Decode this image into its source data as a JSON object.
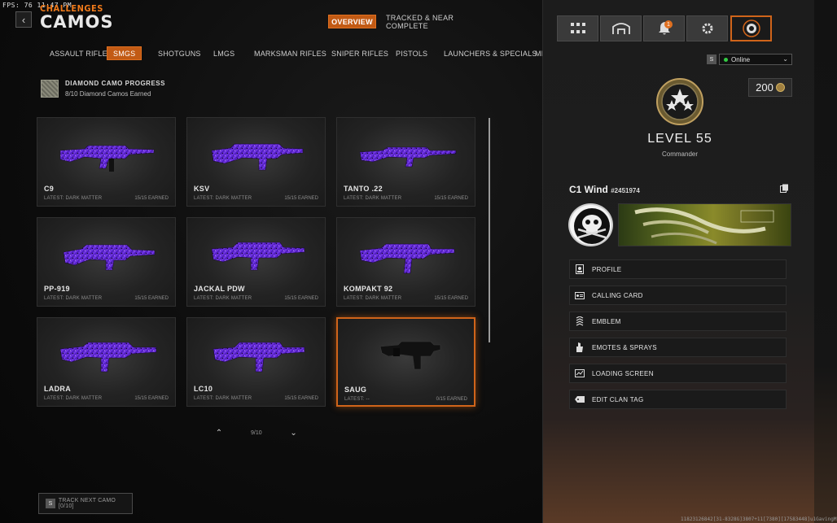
{
  "debug": {
    "fps_text": "FPS: 76  11:47 PM"
  },
  "header": {
    "breadcrumb": "CHALLENGES",
    "title": "CAMOS",
    "tabs": [
      {
        "label": "OVERVIEW",
        "active": true
      },
      {
        "label": "TRACKED & NEAR COMPLETE",
        "active": false
      }
    ]
  },
  "categories": [
    {
      "label": "ASSAULT RIFLES",
      "active": false
    },
    {
      "label": "SMGS",
      "active": true
    },
    {
      "label": "SHOTGUNS",
      "active": false
    },
    {
      "label": "LMGS",
      "active": false
    },
    {
      "label": "MARKSMAN RIFLES",
      "active": false
    },
    {
      "label": "SNIPER RIFLES",
      "active": false
    },
    {
      "label": "PISTOLS",
      "active": false
    },
    {
      "label": "LAUNCHERS & SPECIALS",
      "active": false
    },
    {
      "label": "MELEE",
      "active": false
    }
  ],
  "diamond_progress": {
    "title": "DIAMOND CAMO PROGRESS",
    "subtitle": "8/10 Diamond Camos Earned"
  },
  "weapons": [
    {
      "name": "C9",
      "latest": "LATEST: DARK MATTER",
      "earned": "15/15 EARNED",
      "camo": "dark-matter"
    },
    {
      "name": "KSV",
      "latest": "LATEST: DARK MATTER",
      "earned": "15/15 EARNED",
      "camo": "dark-matter"
    },
    {
      "name": "TANTO .22",
      "latest": "LATEST: DARK MATTER",
      "earned": "15/15 EARNED",
      "camo": "dark-matter"
    },
    {
      "name": "PP-919",
      "latest": "LATEST: DARK MATTER",
      "earned": "15/15 EARNED",
      "camo": "dark-matter"
    },
    {
      "name": "JACKAL PDW",
      "latest": "LATEST: DARK MATTER",
      "earned": "15/15 EARNED",
      "camo": "dark-matter"
    },
    {
      "name": "KOMPAKT 92",
      "latest": "LATEST: DARK MATTER",
      "earned": "15/15 EARNED",
      "camo": "dark-matter"
    },
    {
      "name": "LADRA",
      "latest": "LATEST: DARK MATTER",
      "earned": "15/15 EARNED",
      "camo": "dark-matter"
    },
    {
      "name": "LC10",
      "latest": "LATEST: DARK MATTER",
      "earned": "15/15 EARNED",
      "camo": "dark-matter"
    },
    {
      "name": "SAUG",
      "latest": "LATEST: --",
      "earned": "0/15 EARNED",
      "camo": "none",
      "selected": true
    }
  ],
  "pager": {
    "page": "9/10",
    "prev_icon": "chevron-up-icon",
    "next_icon": "chevron-down-icon"
  },
  "track_button": {
    "key": "S",
    "label": "TRACK NEXT CAMO [0/10]"
  },
  "side_panel": {
    "icons": [
      {
        "name": "grid-icon"
      },
      {
        "name": "barracks-icon"
      },
      {
        "name": "notifications-icon",
        "badge": "1"
      },
      {
        "name": "gear-icon"
      },
      {
        "name": "player-card-icon",
        "active": true
      }
    ],
    "status": {
      "key": "S",
      "value": "Online",
      "color": "#33cc44"
    },
    "cod_points": "200",
    "level": "LEVEL 55",
    "rank_title": "Commander",
    "player": {
      "name": "C1 Wind",
      "tag": "#2451974"
    },
    "menu": [
      {
        "label": "PROFILE",
        "icon": "profile-icon"
      },
      {
        "label": "CALLING CARD",
        "icon": "calling-card-icon"
      },
      {
        "label": "EMBLEM",
        "icon": "emblem-icon"
      },
      {
        "label": "EMOTES & SPRAYS",
        "icon": "emotes-icon"
      },
      {
        "label": "LOADING SCREEN",
        "icon": "loading-screen-icon"
      },
      {
        "label": "EDIT CLAN TAG",
        "icon": "clan-tag-icon"
      }
    ]
  },
  "footer": {
    "build_id": "11823126842[31-8328G]3807+11[7380][17583448]u1GavingM"
  },
  "colors": {
    "accent": "#c25a14",
    "accent_border": "#e07020",
    "camo_purple": "#6a2ad0",
    "online": "#33cc44"
  }
}
